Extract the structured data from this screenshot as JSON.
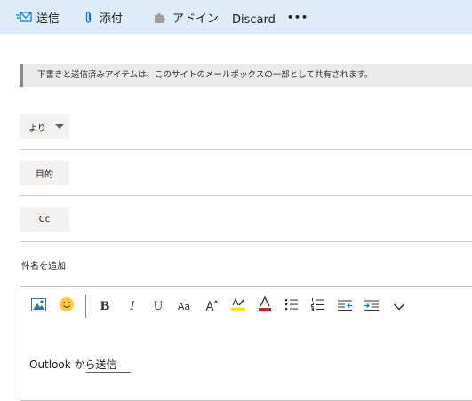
{
  "toolbar": {
    "send_label": "送信",
    "attach_label": "添付",
    "addins_label": "アドイン",
    "discard_label": "Discard",
    "more_label": "•••"
  },
  "notice": {
    "text": "下書きと送信済みアイテムは、このサイトのメールボックスの一部として共有されます。"
  },
  "fields": {
    "from_label": "より",
    "to_label": "目的",
    "cc_label": "Cc",
    "subject_placeholder": "件名を追加"
  },
  "format_toolbar": {
    "bold": "B",
    "italic": "I",
    "underline": "U",
    "font_size": "Aa"
  },
  "body": {
    "text": "Outlook から送信"
  },
  "colors": {
    "toolbar_bg": "#deecf9",
    "accent": "#0078d4",
    "highlight": "#fde300",
    "font_color": "#e81123"
  }
}
